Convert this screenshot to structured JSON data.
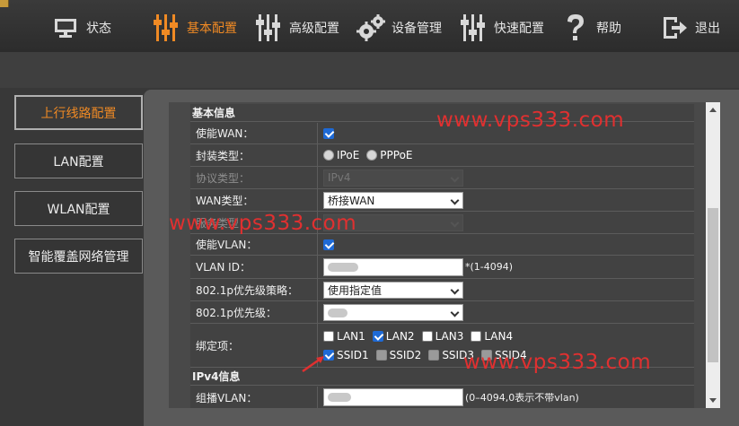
{
  "nav": [
    {
      "label": "状态",
      "icon": "monitor-icon",
      "active": false
    },
    {
      "label": "基本配置",
      "icon": "sliders-icon",
      "active": true
    },
    {
      "label": "高级配置",
      "icon": "sliders-icon",
      "active": false
    },
    {
      "label": "设备管理",
      "icon": "gears-icon",
      "active": false
    },
    {
      "label": "快速配置",
      "icon": "sliders-icon",
      "active": false
    },
    {
      "label": "帮助",
      "icon": "question-icon",
      "active": false
    },
    {
      "label": "退出",
      "icon": "logout-icon",
      "active": false
    }
  ],
  "sidebar": [
    {
      "label": "上行线路配置",
      "active": true
    },
    {
      "label": "LAN配置",
      "active": false
    },
    {
      "label": "WLAN配置",
      "active": false
    },
    {
      "label": "智能覆盖网络管理",
      "active": false
    }
  ],
  "form": {
    "basic_title": "基本信息",
    "enable_wan": {
      "label": "使能WAN：",
      "checked": true
    },
    "encap": {
      "label": "封装类型：",
      "options": [
        "IPoE",
        "PPPoE"
      ]
    },
    "protocol": {
      "label": "协议类型：",
      "value": "IPv4"
    },
    "wan_type": {
      "label": "WAN类型：",
      "value": "桥接WAN"
    },
    "service": {
      "label": "服务类型："
    },
    "enable_vlan": {
      "label": "使能VLAN：",
      "checked": true
    },
    "vlan_id": {
      "label": "VLAN ID：",
      "hint": "*(1-4094)"
    },
    "p8021_policy": {
      "label": "802.1p优先级策略：",
      "value": "使用指定值"
    },
    "p8021": {
      "label": "802.1p优先级："
    },
    "binding": {
      "label": "绑定项：",
      "lan": [
        {
          "name": "LAN1",
          "checked": false
        },
        {
          "name": "LAN2",
          "checked": true
        },
        {
          "name": "LAN3",
          "checked": false
        },
        {
          "name": "LAN4",
          "checked": false
        }
      ],
      "ssid": [
        {
          "name": "SSID1",
          "checked": true
        },
        {
          "name": "SSID2",
          "checked": false
        },
        {
          "name": "SSID3",
          "checked": false
        },
        {
          "name": "SSID4",
          "checked": false
        }
      ]
    },
    "ipv4_title": "IPv4信息",
    "multicast_vlan": {
      "label": "组播VLAN：",
      "hint": "(0–4094,0表示不带vlan)"
    }
  },
  "watermarks": [
    "www.vps333.com",
    "www.vps333.com",
    "www.vps333.com"
  ],
  "colors": {
    "accent": "#f08a24",
    "watermark": "#e03030",
    "check": "#1e6ad6"
  }
}
